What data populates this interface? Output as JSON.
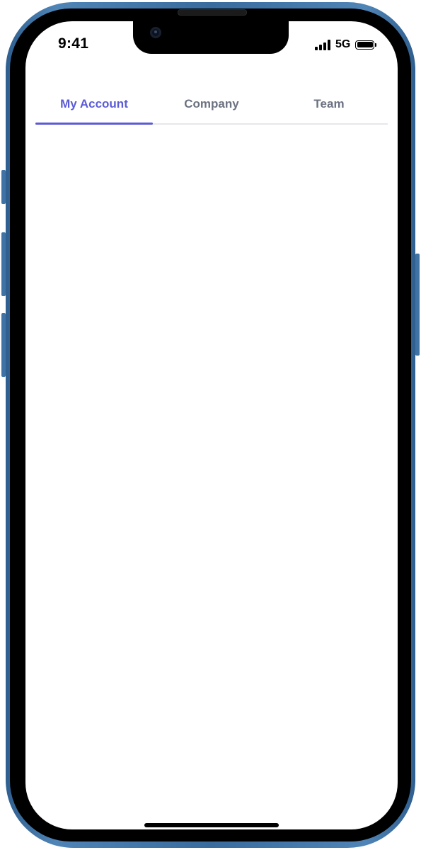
{
  "status_bar": {
    "time": "9:41",
    "network": "5G",
    "signal_icon": "cellular-signal-icon",
    "battery_icon": "battery-icon"
  },
  "tabs": [
    {
      "label": "My Account",
      "active": true
    },
    {
      "label": "Company",
      "active": false
    },
    {
      "label": "Team",
      "active": false
    }
  ],
  "colors": {
    "accent": "#5b5bd6",
    "inactive_tab": "#6b7280",
    "frame": "#3a6c9e"
  }
}
